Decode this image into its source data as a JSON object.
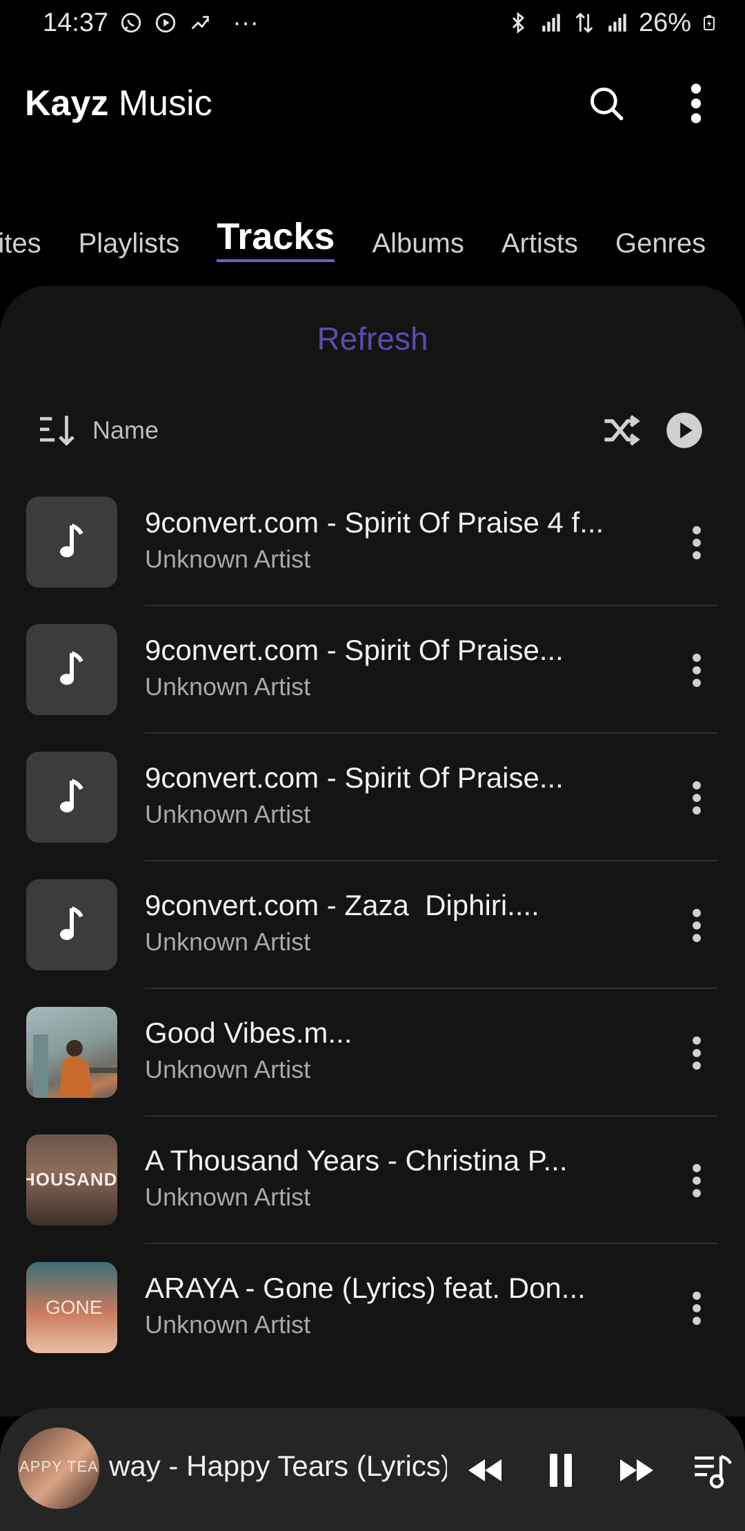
{
  "status_bar": {
    "time": "14:37",
    "battery": "26%",
    "more_indicator": "···"
  },
  "header": {
    "brand": "Kayz",
    "title_rest": " Music"
  },
  "tabs": [
    {
      "label": "rites",
      "active": false
    },
    {
      "label": "Playlists",
      "active": false
    },
    {
      "label": "Tracks",
      "active": true
    },
    {
      "label": "Albums",
      "active": false
    },
    {
      "label": "Artists",
      "active": false
    },
    {
      "label": "Genres",
      "active": false
    }
  ],
  "panel": {
    "refresh_label": "Refresh",
    "sort_label": "Name"
  },
  "tracks": [
    {
      "title": "9convert.com - Spirit Of Praise 4 f...",
      "artist": "Unknown Artist",
      "art": "music-note-icon"
    },
    {
      "title": "9convert.com - Spirit Of Praise...",
      "artist": "Unknown Artist",
      "art": "music-note-icon"
    },
    {
      "title": "9convert.com - Spirit Of Praise...",
      "artist": "Unknown Artist",
      "art": "music-note-icon"
    },
    {
      "title": "9convert.com - Zaza  Diphiri....",
      "artist": "Unknown Artist",
      "art": "music-note-icon"
    },
    {
      "title": "Good Vibes.m...",
      "artist": "Unknown Artist",
      "art": "album-art-photo"
    },
    {
      "title": "A Thousand Years - Christina P...",
      "artist": "Unknown Artist",
      "art": "album-art-thousand-years",
      "art_text": "HOUSAND YE"
    },
    {
      "title": "ARAYA - Gone (Lyrics) feat. Don...",
      "artist": "Unknown Artist",
      "art": "album-art-gone",
      "art_text": "GONE"
    }
  ],
  "mini_player": {
    "title": "way - Happy Tears (Lyrics)",
    "cover_text": "APPY TEAR"
  },
  "colors": {
    "accent": "#6f5fd0",
    "refresh": "#5b4cb0",
    "panel_bg": "#141414",
    "player_bg": "#252525"
  }
}
